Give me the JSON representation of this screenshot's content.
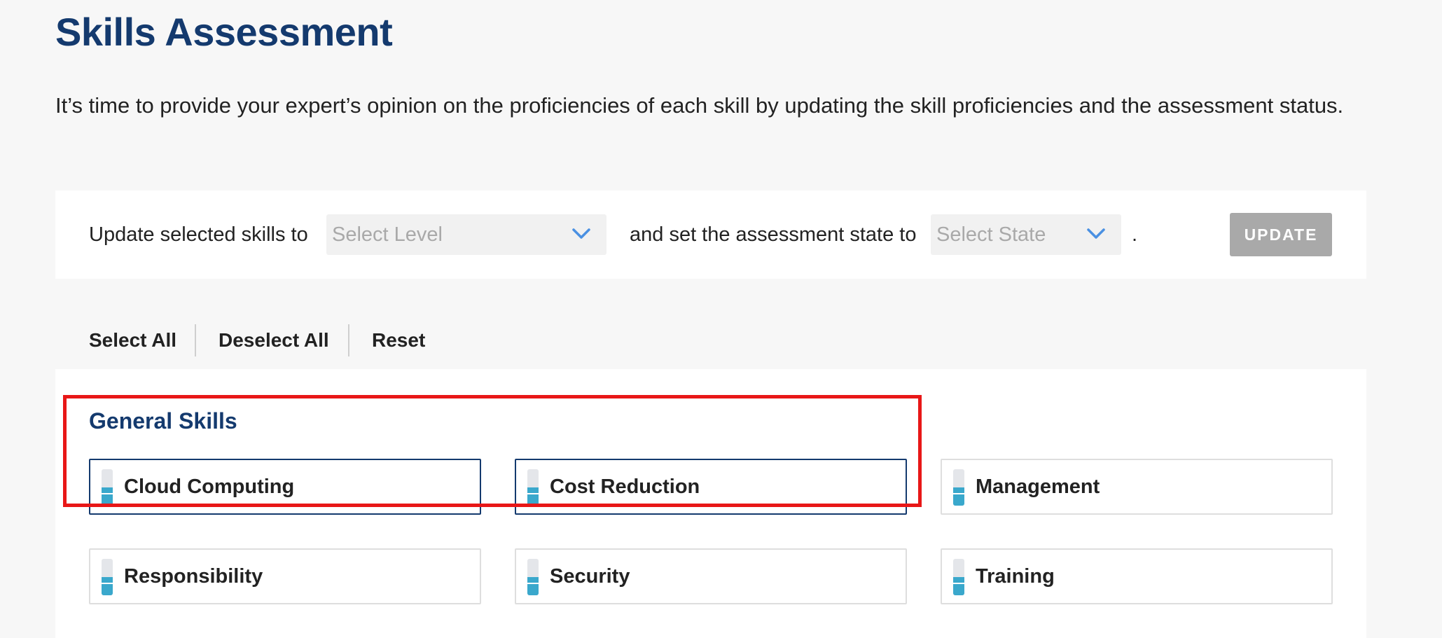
{
  "page": {
    "title": "Skills Assessment",
    "intro": "It’s time to provide your expert’s opinion on the proficiencies of each skill by updating the skill proficiencies and the assessment status."
  },
  "update_bar": {
    "prefix_text": "Update selected skills to",
    "level_select": {
      "placeholder": "Select Level",
      "icon": "chevron-down-icon"
    },
    "middle_text": "and set the assessment state to",
    "state_select": {
      "placeholder": "Select State",
      "icon": "chevron-down-icon"
    },
    "suffix_text": ".",
    "update_button_label": "UPDATE"
  },
  "actions": {
    "select_all": "Select All",
    "deselect_all": "Deselect All",
    "reset": "Reset"
  },
  "skill_groups": [
    {
      "title": "General Skills",
      "skills": [
        {
          "name": "Cloud Computing",
          "selected": true,
          "level_fraction": 0.5
        },
        {
          "name": "Cost Reduction",
          "selected": true,
          "level_fraction": 0.5
        },
        {
          "name": "Management",
          "selected": false,
          "level_fraction": 0.5
        },
        {
          "name": "Responsibility",
          "selected": false,
          "level_fraction": 0.5
        },
        {
          "name": "Security",
          "selected": false,
          "level_fraction": 0.5
        },
        {
          "name": "Training",
          "selected": false,
          "level_fraction": 0.5
        }
      ]
    }
  ],
  "colors": {
    "title_navy": "#143a6e",
    "accent_blue": "#4a90e2",
    "meter_fill": "#3aa8cc",
    "highlight_red": "#e81717",
    "disabled_button": "#a9a9a9"
  }
}
